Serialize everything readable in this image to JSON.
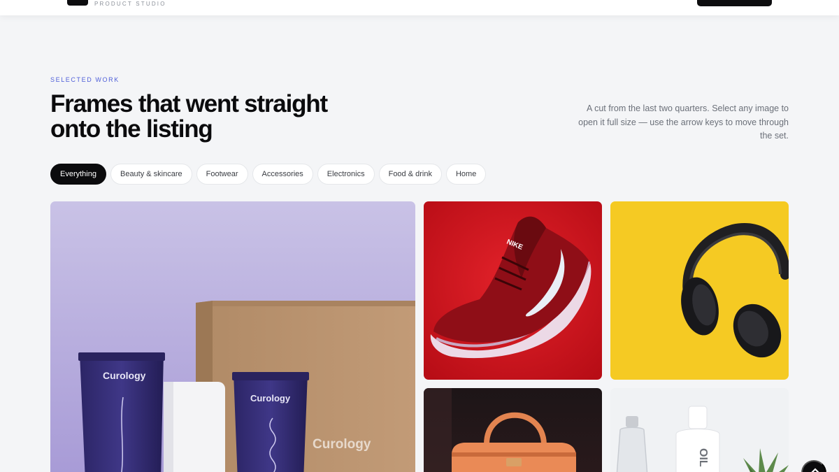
{
  "header": {
    "logo_subtitle": "PRODUCT STUDIO"
  },
  "section": {
    "eyebrow": "SELECTED WORK",
    "title_line1": "Frames that went straight",
    "title_line2": "onto the listing",
    "intro": "A cut from the last two quarters. Select any image to open it full size — use the arrow keys to move through the set."
  },
  "filters": [
    {
      "label": "Everything",
      "active": true
    },
    {
      "label": "Beauty & skincare",
      "active": false
    },
    {
      "label": "Footwear",
      "active": false
    },
    {
      "label": "Accessories",
      "active": false
    },
    {
      "label": "Electronics",
      "active": false
    },
    {
      "label": "Food & drink",
      "active": false
    },
    {
      "label": "Home",
      "active": false
    }
  ],
  "gallery": {
    "main_tile": {
      "brand_text": "Curology",
      "icon": "skincare-product-photo"
    },
    "tiles": [
      {
        "icon": "sneaker-product-photo",
        "brand_text": "NIKE"
      },
      {
        "icon": "headphones-product-photo"
      },
      {
        "icon": "handbag-product-photo"
      },
      {
        "icon": "oil-bottles-product-photo",
        "brand_text": "OIL"
      }
    ]
  },
  "colors": {
    "accent": "#4f5fd9",
    "active_chip": "#0b0b0d",
    "background": "#f4f5f7"
  }
}
